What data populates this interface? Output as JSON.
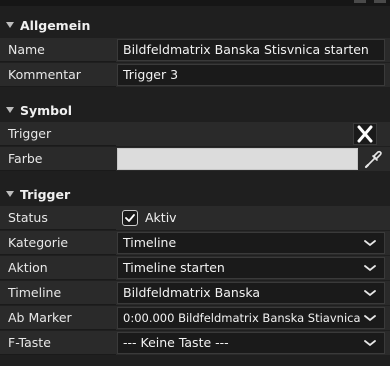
{
  "sections": {
    "allgemein": "Allgemein",
    "symbol": "Symbol",
    "trigger": "Trigger"
  },
  "allgemein": {
    "name_label": "Name",
    "name_value": "Bildfeldmatrix Banska Stisvnica  starten",
    "kommentar_label": "Kommentar",
    "kommentar_value": "Trigger 3"
  },
  "symbol": {
    "trigger_label": "Trigger",
    "farbe_label": "Farbe",
    "farbe_color": "#dcdcdc",
    "clear_icon": "close-icon",
    "picker_icon": "eyedropper-icon"
  },
  "trigger": {
    "status_label": "Status",
    "status_checked": true,
    "status_value": "Aktiv",
    "kategorie_label": "Kategorie",
    "kategorie_value": "Timeline",
    "aktion_label": "Aktion",
    "aktion_value": "Timeline starten",
    "timeline_label": "Timeline",
    "timeline_value": "Bildfeldmatrix Banska",
    "marker_label": "Ab Marker",
    "marker_value": "0:00.000  Bildfeldmatrix Banska Stiavnica",
    "ftaste_label": "F-Taste",
    "ftaste_value": "--- Keine Taste ---"
  }
}
